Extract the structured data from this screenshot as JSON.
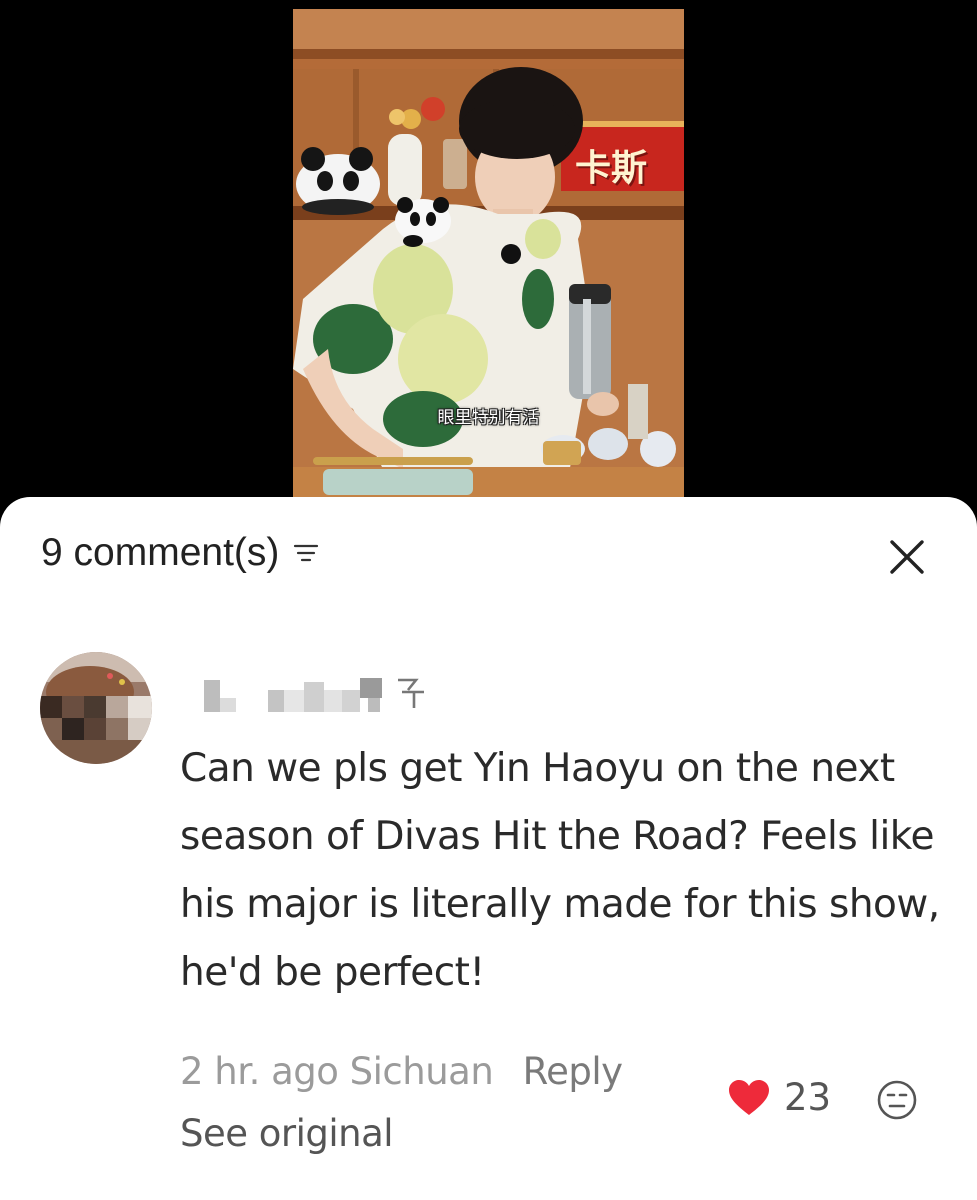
{
  "video": {
    "subtitle": "眼里特别有活",
    "banner_text": "卡斯"
  },
  "comments_panel": {
    "count_label": "9 comment(s)",
    "sort_icon": "sort-lines-icon",
    "close_icon": "close-x-icon"
  },
  "comment": {
    "text": "Can we pls get Yin Haoyu on the next season of Divas Hit the Road? Feels like his major is literally made for this show, he'd be perfect!",
    "time": "2 hr. ago",
    "location": "Sichuan",
    "reply_label": "Reply",
    "see_original_label": "See original",
    "like_count": "23",
    "liked": true,
    "heart_color": "#ee2a3a",
    "emoji_icon": "neutral-face-icon"
  }
}
